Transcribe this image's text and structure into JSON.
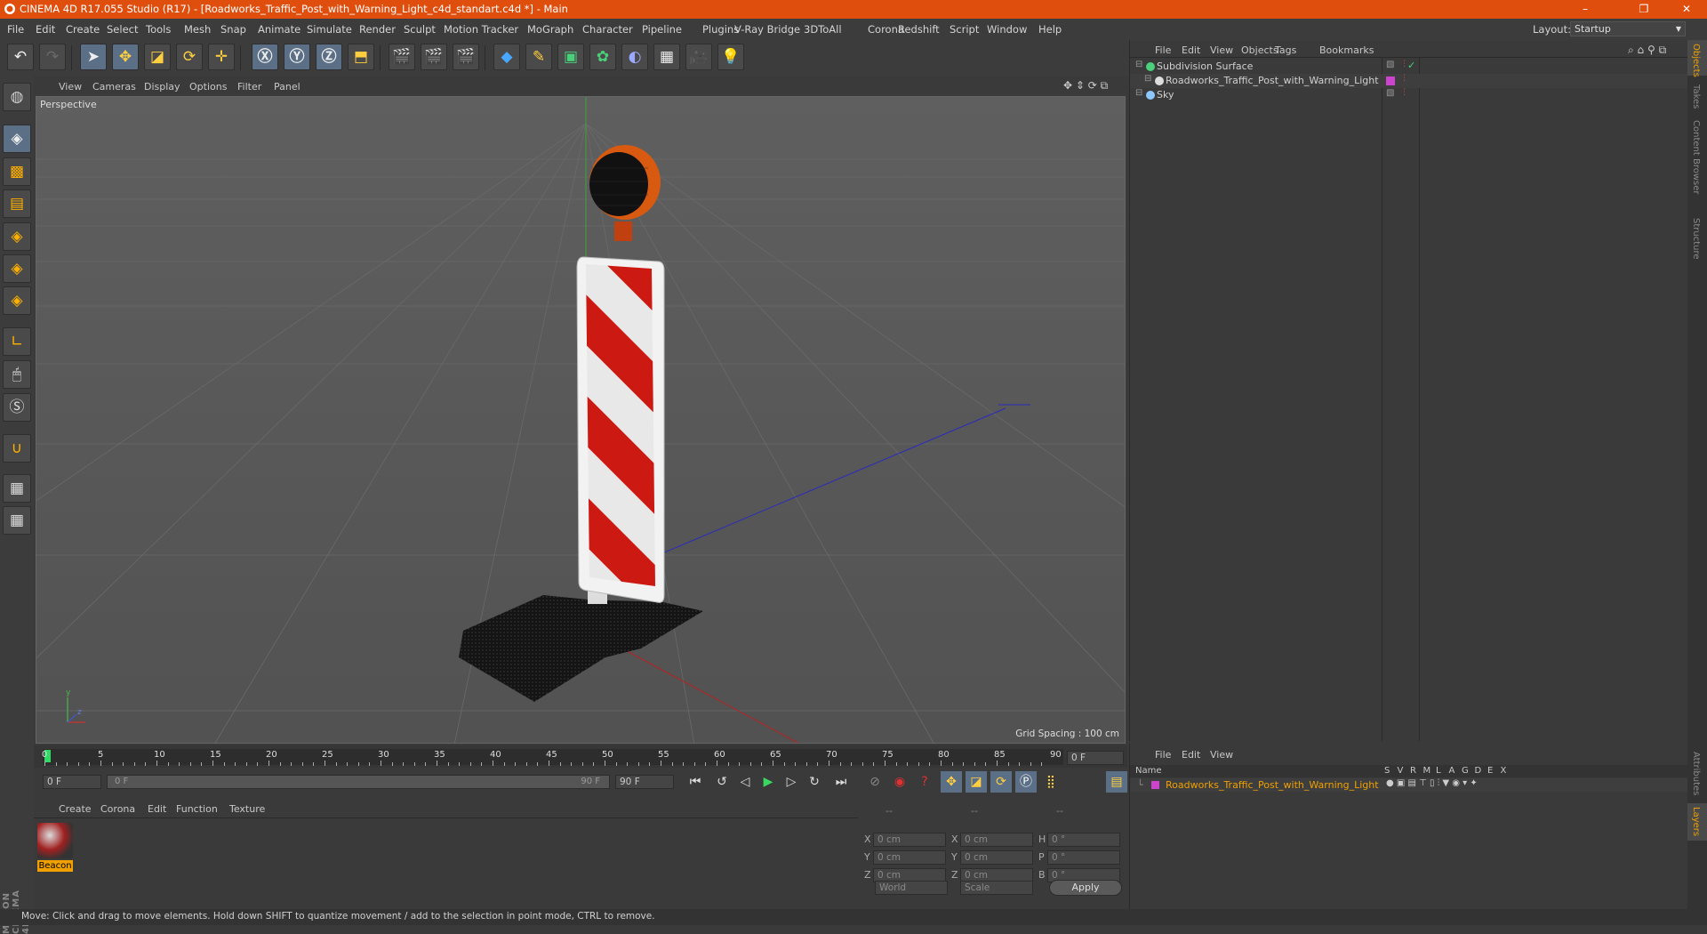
{
  "window": {
    "title": "CINEMA 4D R17.055 Studio (R17) - [Roadworks_Traffic_Post_with_Warning_Light_c4d_standart.c4d *] - Main",
    "min": "–",
    "max": "❐",
    "close": "✕"
  },
  "menu": [
    "File",
    "Edit",
    "Create",
    "Select",
    "Tools",
    "Mesh",
    "Snap",
    "Animate",
    "Simulate",
    "Render",
    "Sculpt",
    "Motion Tracker",
    "MoGraph",
    "Character",
    "Pipeline",
    "Plugins",
    "V-Ray Bridge",
    "3DToAll",
    "Corona",
    "Redshift",
    "Script",
    "Window",
    "Help"
  ],
  "layout": {
    "label": "Layout:",
    "value": "Startup"
  },
  "viewport": {
    "menu": [
      "View",
      "Cameras",
      "Display",
      "Options",
      "Filter",
      "Panel"
    ],
    "camera_label": "Perspective",
    "grid_spacing": "Grid Spacing : 100 cm"
  },
  "timeline": {
    "ticks": [
      "0",
      "5",
      "10",
      "15",
      "20",
      "25",
      "30",
      "35",
      "40",
      "45",
      "50",
      "55",
      "60",
      "65",
      "70",
      "75",
      "80",
      "85",
      "90"
    ],
    "current_frame": "0 F"
  },
  "transport": {
    "start_field": "0 F",
    "range_start": "0 F",
    "range_end": "90 F",
    "end_field": "90 F"
  },
  "material_panel": {
    "menu": [
      "Create",
      "Corona",
      "Edit",
      "Function",
      "Texture"
    ],
    "materials": [
      {
        "name": "Beacon"
      }
    ]
  },
  "coordinates": {
    "headers": [
      "--",
      "--",
      "--"
    ],
    "rows": [
      {
        "a": "X",
        "av": "0 cm",
        "b": "X",
        "bv": "0 cm",
        "c": "H",
        "cv": "0 °"
      },
      {
        "a": "Y",
        "av": "0 cm",
        "b": "Y",
        "bv": "0 cm",
        "c": "P",
        "cv": "0 °"
      },
      {
        "a": "Z",
        "av": "0 cm",
        "b": "Z",
        "bv": "0 cm",
        "c": "B",
        "cv": "0 °"
      }
    ],
    "mode1": "World",
    "mode2": "Scale",
    "apply": "Apply"
  },
  "object_manager": {
    "menu": [
      "File",
      "Edit",
      "View",
      "Objects",
      "Tags",
      "Bookmarks"
    ],
    "objects": [
      {
        "name": "Subdivision Surface",
        "indent": 0
      },
      {
        "name": "Roadworks_Traffic_Post_with_Warning_Light",
        "indent": 1
      },
      {
        "name": "Sky",
        "indent": 0
      }
    ]
  },
  "layer_manager": {
    "menu": [
      "File",
      "Edit",
      "View"
    ],
    "name_header": "Name",
    "col_headers": [
      "S",
      "V",
      "R",
      "M",
      "L",
      "A",
      "G",
      "D",
      "E",
      "X"
    ],
    "layers": [
      {
        "name": "Roadworks_Traffic_Post_with_Warning_Light"
      }
    ]
  },
  "right_tabs": [
    "Objects",
    "Takes",
    "Content Browser",
    "Structure"
  ],
  "right_tabs_bottom": [
    "Attributes",
    "Layers"
  ],
  "brand": "MAXON CINEMA 4D",
  "status": "Move: Click and drag to move elements. Hold down SHIFT to quantize movement / add to the selection in point mode, CTRL to remove.",
  "colors": {
    "titlebar": "#e04e0e",
    "accent_orange": "#f0a000",
    "selected_material": "#f0a000",
    "layer_color": "#cc44cc"
  }
}
